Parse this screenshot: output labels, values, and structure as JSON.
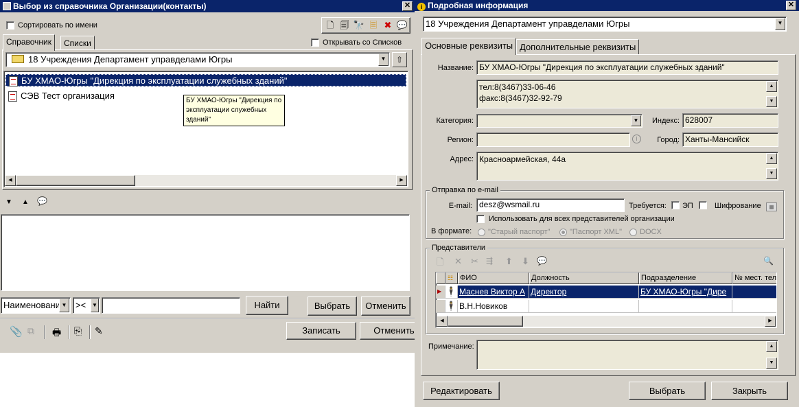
{
  "left": {
    "title": "Выбор из справочника Организации(контакты)",
    "sort_by_name": "Сортировать по имени",
    "tabs": [
      "Справочник",
      "Списки"
    ],
    "open_with_lists": "Открывать со Списков",
    "folder": "18 Учреждения Департамент управделами Югры",
    "items": [
      "БУ ХМАО-Югры \"Дирекция по эксплуатации служебных зданий\"",
      "СЭВ Тест организация"
    ],
    "tooltip": "БУ ХМАО-Югры \"Дирекция по эксплуатации служебных зданий\"",
    "search_field": "Наименовани",
    "search_op": "><",
    "search_value": "",
    "find": "Найти",
    "select": "Выбрать",
    "cancel": "Отменить",
    "save": "Записать",
    "cancel2": "Отменить"
  },
  "right": {
    "title": "Подробная информация",
    "org_select": "18 Учреждения Департамент управделами Югры",
    "tabs": [
      "Основные реквизиты",
      "Дополнительные реквизиты"
    ],
    "name_label": "Название:",
    "name_value": "БУ ХМАО-Югры \"Дирекция по эксплуатации служебных зданий\"",
    "phone": "тел:8(3467)33-06-46",
    "fax": "факс:8(3467)32-92-79",
    "category_label": "Категория:",
    "category_value": "",
    "index_label": "Индекс:",
    "index_value": "628007",
    "region_label": "Регион:",
    "region_value": "",
    "city_label": "Город:",
    "city_value": "Ханты-Мансийск",
    "address_label": "Адрес:",
    "address_value": "Красноармейская, 44а",
    "email_group": "Отправка по e-mail",
    "email_label": "E-mail:",
    "email_value": "desz@wsmail.ru",
    "requires_label": "Требуется:",
    "ep_label": "ЭП",
    "encrypt_label": "Шифрование",
    "use_for_all": "Использовать для всех представителей организации",
    "format_label": "В формате:",
    "formats": [
      "\"Старый паспорт\"",
      "\"Паспорт XML\"",
      "DOCX"
    ],
    "reps_group": "Представители",
    "grid_headers": [
      "ФИО",
      "Должность",
      "Подразделение",
      "№ мест. тел"
    ],
    "grid_rows": [
      {
        "fio": "Маснев Виктор А",
        "position": "Директор",
        "dept": "БУ ХМАО-Югры \"Дире",
        "phone": ""
      },
      {
        "fio": "В.Н.Новиков",
        "position": "",
        "dept": "",
        "phone": ""
      }
    ],
    "note_label": "Примечание:",
    "note_value": "",
    "edit": "Редактировать",
    "select": "Выбрать",
    "close": "Закрыть"
  },
  "colors": {
    "titlebar": "#0a246a",
    "face": "#d4d0c8",
    "selection": "#0a246a"
  }
}
